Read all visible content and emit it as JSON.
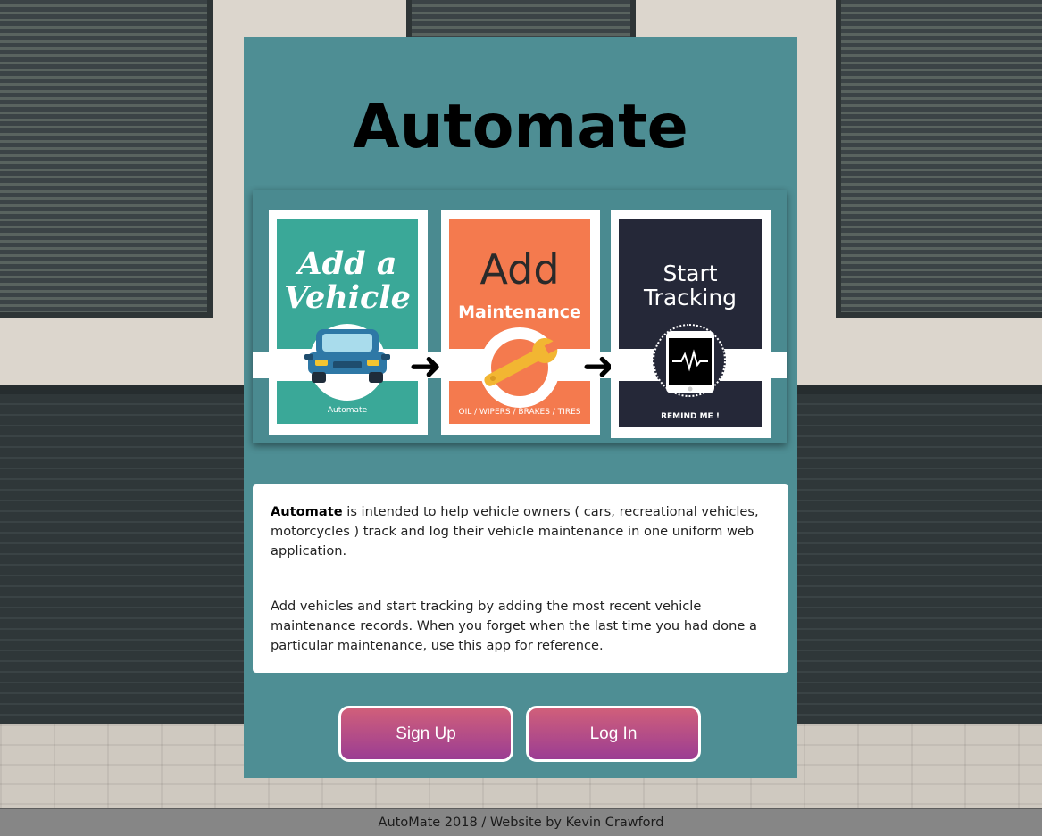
{
  "app": {
    "title": "Automate"
  },
  "hero": {
    "panels": [
      {
        "heading_line1": "Add a",
        "heading_line2": "Vehicle",
        "caption": "Automate",
        "icon": "car-icon"
      },
      {
        "heading": "Add",
        "subheading": "Maintenance",
        "caption": "OIL / WIPERS / BRAKES / TIRES",
        "icon": "wrench-icon"
      },
      {
        "heading_line1": "Start",
        "heading_line2": "Tracking",
        "caption": "REMIND ME !",
        "icon": "phone-heartbeat-icon"
      }
    ],
    "arrow_icon": "arrow-right-icon"
  },
  "description": {
    "brand": "Automate",
    "para1_rest": " is intended to help vehicle owners ( cars, recreational vehicles, motorcycles ) track and log their vehicle maintenance in one uniform web application.",
    "para2": "Add vehicles and start tracking by adding the most recent vehicle maintenance records. When you forget when the last time you had done a particular maintenance, use this app for reference."
  },
  "actions": {
    "signup_label": "Sign Up",
    "login_label": "Log In"
  },
  "footer": {
    "text": "AutoMate 2018 / Website by Kevin Crawford"
  },
  "colors": {
    "card": "#4e8e94",
    "panel_teal": "#3aa898",
    "panel_orange": "#f47a4e",
    "panel_navy": "#252838",
    "button_top": "#d05f7a",
    "button_bottom": "#9b3d93",
    "footer": "#868686"
  }
}
